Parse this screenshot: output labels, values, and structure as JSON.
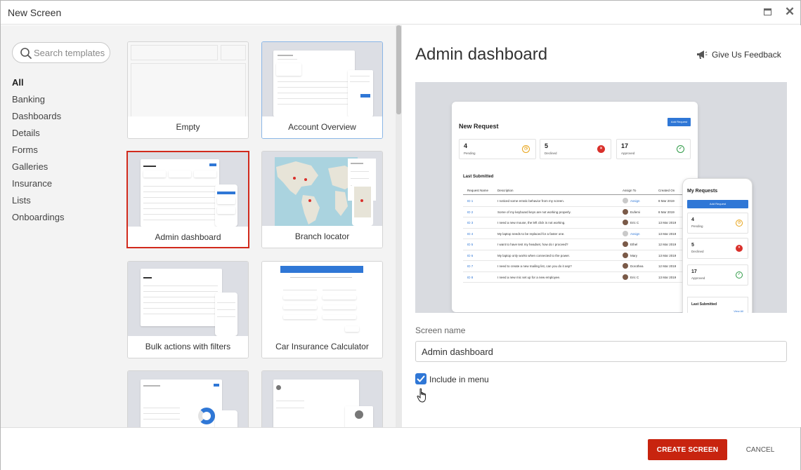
{
  "window": {
    "title": "New Screen"
  },
  "search": {
    "placeholder": "Search templates"
  },
  "categories": [
    "All",
    "Banking",
    "Dashboards",
    "Details",
    "Forms",
    "Galleries",
    "Insurance",
    "Lists",
    "Onboardings"
  ],
  "selected_category": "All",
  "templates": [
    {
      "label": "Empty"
    },
    {
      "label": "Account Overview"
    },
    {
      "label": "Admin dashboard",
      "selected": true
    },
    {
      "label": "Branch locator"
    },
    {
      "label": "Bulk actions with filters"
    },
    {
      "label": "Car Insurance Calculator"
    },
    {
      "label": ""
    },
    {
      "label": ""
    }
  ],
  "detail": {
    "title": "Admin dashboard",
    "feedback_label": "Give Us Feedback",
    "screen_name_label": "Screen name",
    "screen_name_value": "Admin dashboard",
    "include_in_menu_label": "Include in menu",
    "include_in_menu_checked": true
  },
  "preview": {
    "heading": "New Request",
    "add_button": "Add Request",
    "stats": [
      {
        "value": "4",
        "label": "Pending",
        "icon": "clock-icon",
        "color": "#e8a317"
      },
      {
        "value": "5",
        "label": "Declined",
        "icon": "x-circle-icon",
        "color": "#d9302b"
      },
      {
        "value": "17",
        "label": "Approved",
        "icon": "check-circle-icon",
        "color": "#2e9a46"
      }
    ],
    "list_heading": "Last Submitted",
    "columns": [
      "Request Name",
      "Description",
      "Assign To",
      "Created On"
    ],
    "rows": [
      {
        "id": "ID 1",
        "desc": "I noticed some erratic behavior from my screen.",
        "assignee": "Assign",
        "date": "8 Mar 2019"
      },
      {
        "id": "ID 2",
        "desc": "Some of my keyboard keys are not working properly.",
        "assignee": "Eufemi",
        "date": "8 Mar 2019"
      },
      {
        "id": "ID 3",
        "desc": "I need a new mouse, the left click is not working.",
        "assignee": "Eric C",
        "date": "13 Mar 2019"
      },
      {
        "id": "ID 4",
        "desc": "My laptop needs to be replaced for a faster one.",
        "assignee": "Assign",
        "date": "13 Mar 2019"
      },
      {
        "id": "ID 5",
        "desc": "I want to have test my headset, how do I proceed?",
        "assignee": "Ethel",
        "date": "12 Mar 2019"
      },
      {
        "id": "ID 6",
        "desc": "My laptop only works when connected to the power.",
        "assignee": "Mary",
        "date": "13 Mar 2019"
      },
      {
        "id": "ID 7",
        "desc": "I need to create a new mailing list, can you do it asp?",
        "assignee": "Dorothea",
        "date": "12 Mar 2019"
      },
      {
        "id": "ID 8",
        "desc": "I need a new mic set up for a new employee.",
        "assignee": "Eric C",
        "date": "13 Mar 2019"
      }
    ],
    "phone": {
      "heading": "My Requests",
      "add_button": "Add Request",
      "list_heading": "Last Submitted",
      "view_all": "View All"
    }
  },
  "footer": {
    "create_label": "CREATE SCREEN",
    "cancel_label": "CANCEL"
  },
  "colors": {
    "primary": "#c8240f",
    "accent_blue": "#2f77d6",
    "selected_border": "#d12a1c"
  }
}
